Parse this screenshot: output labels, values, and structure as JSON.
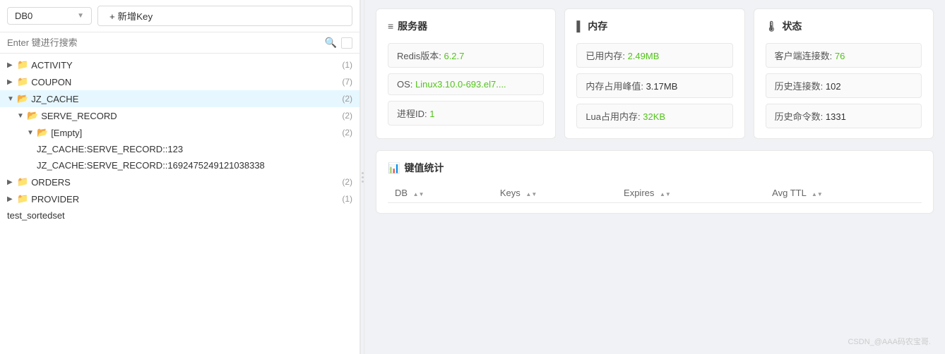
{
  "toolbar": {
    "db_label": "DB0",
    "add_key_label": "+ 新增Key"
  },
  "search": {
    "placeholder": "Enter 键进行搜索"
  },
  "tree": {
    "items": [
      {
        "id": "activity",
        "label": "ACTIVITY",
        "count": "(1)",
        "level": 0,
        "type": "folder-collapsed"
      },
      {
        "id": "coupon",
        "label": "COUPON",
        "count": "(7)",
        "level": 0,
        "type": "folder-collapsed"
      },
      {
        "id": "jz_cache",
        "label": "JZ_CACHE",
        "count": "(2)",
        "level": 0,
        "type": "folder-open",
        "active": true
      },
      {
        "id": "serve_record",
        "label": "SERVE_RECORD",
        "count": "(2)",
        "level": 1,
        "type": "folder-open"
      },
      {
        "id": "empty",
        "label": "[Empty]",
        "count": "(2)",
        "level": 2,
        "type": "folder-open"
      },
      {
        "id": "key1",
        "label": "JZ_CACHE:SERVE_RECORD::123",
        "level": 3,
        "type": "key"
      },
      {
        "id": "key2",
        "label": "JZ_CACHE:SERVE_RECORD::1692475249121038338",
        "level": 3,
        "type": "key"
      },
      {
        "id": "orders",
        "label": "ORDERS",
        "count": "(2)",
        "level": 0,
        "type": "folder-collapsed"
      },
      {
        "id": "provider",
        "label": "PROVIDER",
        "count": "(1)",
        "level": 0,
        "type": "folder-collapsed"
      },
      {
        "id": "test_sortedset",
        "label": "test_sortedset",
        "level": 0,
        "type": "key"
      }
    ]
  },
  "server_card": {
    "title": "服务器",
    "icon": "🖥",
    "items": [
      {
        "label": "Redis版本: ",
        "value": "6.2.7",
        "value_class": "green"
      },
      {
        "label": "OS: ",
        "value": "Linux3.10.0-693.el7....",
        "value_class": "green"
      },
      {
        "label": "进程ID: ",
        "value": "1",
        "value_class": "green"
      }
    ]
  },
  "memory_card": {
    "title": "内存",
    "icon": "📋",
    "items": [
      {
        "label": "已用内存: ",
        "value": "2.49MB",
        "value_class": "green"
      },
      {
        "label": "内存占用峰值: ",
        "value": "3.17MB",
        "value_class": "normal"
      },
      {
        "label": "Lua占用内存: ",
        "value": "32KB",
        "value_class": "green"
      }
    ]
  },
  "status_card": {
    "title": "状态",
    "icon": "🌡",
    "items": [
      {
        "label": "客户端连接数: ",
        "value": "76",
        "value_class": "green"
      },
      {
        "label": "历史连接数: ",
        "value": "102",
        "value_class": "normal"
      },
      {
        "label": "历史命令数: ",
        "value": "1331",
        "value_class": "normal"
      }
    ]
  },
  "kv_section": {
    "title": "键值统计",
    "icon": "📊",
    "columns": [
      "DB",
      "Keys",
      "Expires",
      "Avg TTL"
    ]
  },
  "watermark": "CSDN_@AAA码农宝哥."
}
